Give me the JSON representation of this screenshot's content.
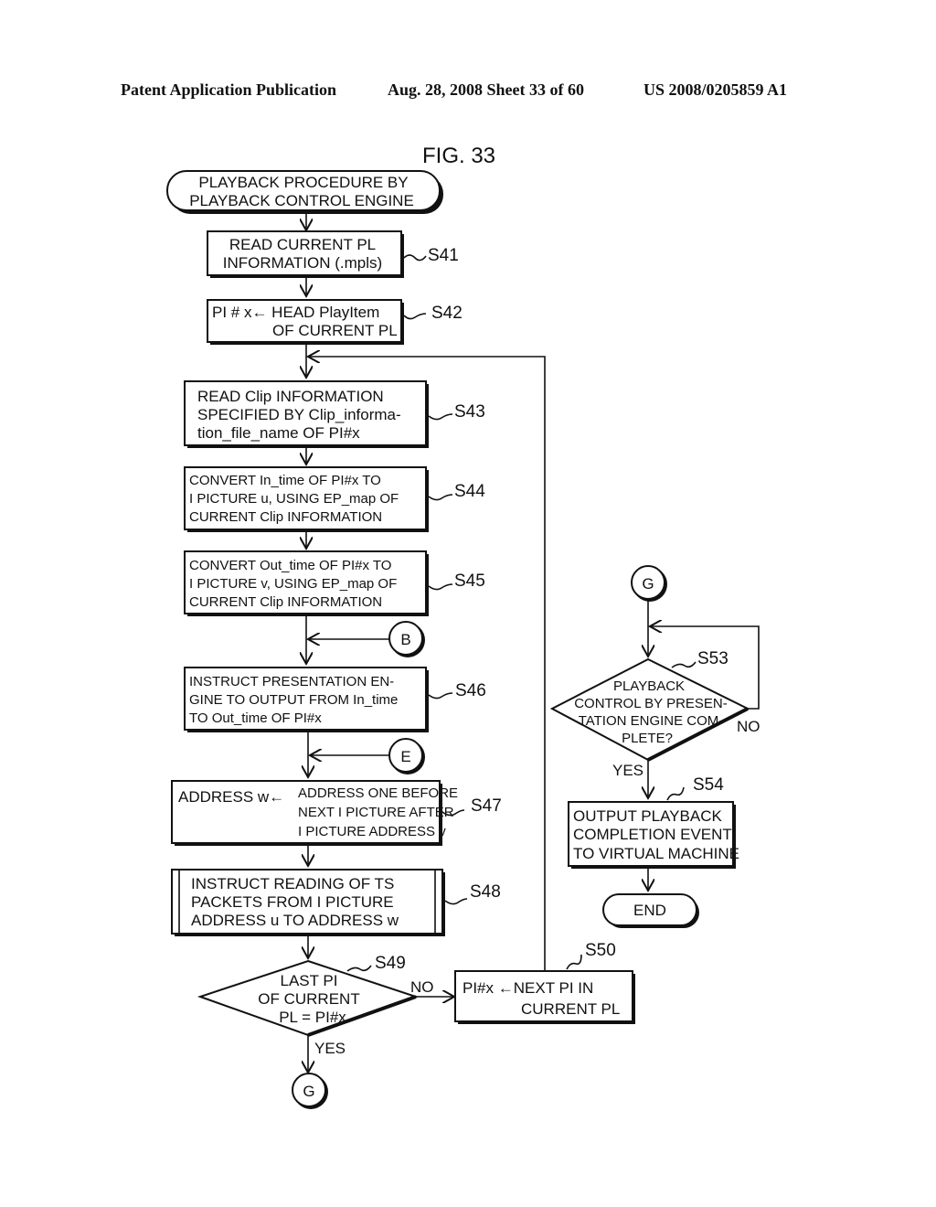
{
  "header": {
    "publication": "Patent Application Publication",
    "date_sheet": "Aug. 28, 2008  Sheet 33 of 60",
    "number": "US 2008/0205859 A1"
  },
  "figure": {
    "title": "FIG. 33",
    "start": [
      "PLAYBACK PROCEDURE BY",
      "PLAYBACK CONTROL ENGINE"
    ],
    "end": "END",
    "steps": {
      "s41": {
        "label": "S41",
        "lines": [
          "READ CURRENT PL",
          "INFORMATION (.mpls)"
        ]
      },
      "s42": {
        "label": "S42",
        "lines": [
          "PI # x← HEAD PlayItem",
          "OF CURRENT PL"
        ]
      },
      "s43": {
        "label": "S43",
        "lines": [
          "READ Clip INFORMATION",
          "SPECIFIED BY Clip_informa-",
          "tion_file_name OF PI#x"
        ]
      },
      "s44": {
        "label": "S44",
        "lines": [
          "CONVERT In_time OF PI#x TO",
          "I PICTURE u, USING EP_map OF",
          "CURRENT Clip INFORMATION"
        ]
      },
      "s45": {
        "label": "S45",
        "lines": [
          "CONVERT Out_time OF PI#x TO",
          "I PICTURE v, USING EP_map OF",
          "CURRENT Clip INFORMATION"
        ]
      },
      "s46": {
        "label": "S46",
        "lines": [
          "INSTRUCT  PRESENTATION  EN-",
          "GINE TO OUTPUT FROM In_time",
          "TO Out_time OF PI#x"
        ]
      },
      "s47": {
        "label": "S47",
        "left": "ADDRESS w←",
        "lines": [
          "ADDRESS ONE BEFORE",
          "NEXT I PICTURE AFTER",
          "I PICTURE ADDRESS v"
        ]
      },
      "s48": {
        "label": "S48",
        "lines": [
          "INSTRUCT  READING  OF  TS",
          "PACKETS  FROM  I  PICTURE",
          "ADDRESS u TO ADDRESS w"
        ]
      },
      "s49": {
        "label": "S49",
        "lines": [
          "LAST PI",
          "OF CURRENT",
          "PL = PI#x"
        ],
        "yes": "YES",
        "no": "NO"
      },
      "s50": {
        "label": "S50",
        "lines": [
          "PI#x ←NEXT PI IN",
          "CURRENT PL"
        ]
      },
      "s53": {
        "label": "S53",
        "lines": [
          "PLAYBACK",
          "CONTROL BY PRESEN-",
          "TATION ENGINE COM-",
          "PLETE?"
        ],
        "yes": "YES",
        "no": "NO"
      },
      "s54": {
        "label": "S54",
        "lines": [
          "OUTPUT   PLAYBACK",
          "COMPLETION   EVENT",
          "TO VIRTUAL MACHINE"
        ]
      }
    },
    "connectors": {
      "b": "B",
      "e": "E",
      "g_out": "G",
      "g_in": "G"
    }
  }
}
